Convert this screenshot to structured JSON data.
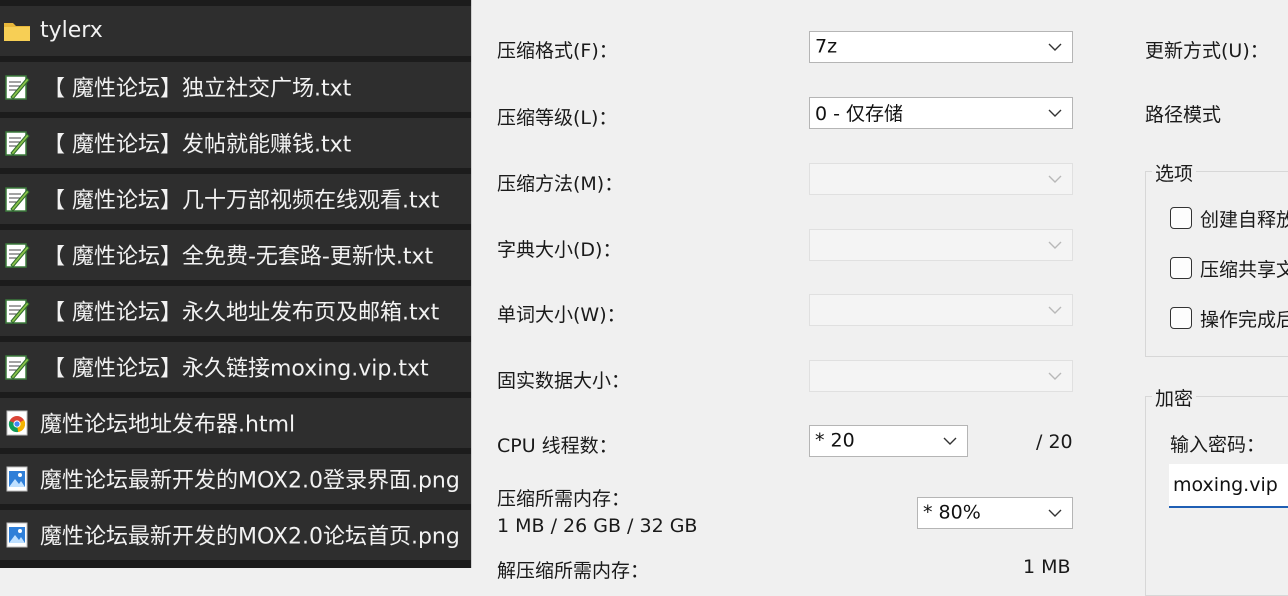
{
  "file_list": [
    {
      "name": "tylerx",
      "type": "folder",
      "icon": "folder-icon"
    },
    {
      "name": "【 魔性论坛】独立社交广场.txt",
      "type": "txt",
      "icon": "text-file-icon"
    },
    {
      "name": "【 魔性论坛】发帖就能赚钱.txt",
      "type": "txt",
      "icon": "text-file-icon"
    },
    {
      "name": "【 魔性论坛】几十万部视频在线观看.txt",
      "type": "txt",
      "icon": "text-file-icon"
    },
    {
      "name": "【 魔性论坛】全免费-无套路-更新快.txt",
      "type": "txt",
      "icon": "text-file-icon"
    },
    {
      "name": "【 魔性论坛】永久地址发布页及邮箱.txt",
      "type": "txt",
      "icon": "text-file-icon"
    },
    {
      "name": "【 魔性论坛】永久链接moxing.vip.txt",
      "type": "txt",
      "icon": "text-file-icon"
    },
    {
      "name": "魔性论坛地址发布器.html",
      "type": "html",
      "icon": "chrome-icon"
    },
    {
      "name": "魔性论坛最新开发的MOX2.0登录界面.png",
      "type": "image",
      "icon": "image-file-icon"
    },
    {
      "name": "魔性论坛最新开发的MOX2.0论坛首页.png",
      "type": "image",
      "icon": "image-file-icon"
    }
  ],
  "dialog": {
    "format": {
      "label": "压缩格式(F)：",
      "value": "7z"
    },
    "level": {
      "label": "压缩等级(L)：",
      "value": "0 - 仅存储"
    },
    "method": {
      "label": "压缩方法(M)：",
      "value": ""
    },
    "dict_size": {
      "label": "字典大小(D)：",
      "value": ""
    },
    "word_size": {
      "label": "单词大小(W)：",
      "value": ""
    },
    "solid_size": {
      "label": "固实数据大小：",
      "value": ""
    },
    "cpu_threads": {
      "label": "CPU 线程数：",
      "value": "*  20",
      "max": "/ 20"
    },
    "memory_compress": {
      "label": "压缩所需内存：",
      "detail": "1 MB / 26 GB / 32 GB",
      "value": "*  80%"
    },
    "memory_decompress": {
      "label": "解压缩所需内存：",
      "value": "1 MB"
    },
    "update_mode": {
      "label": "更新方式(U)："
    },
    "path_mode": {
      "label": "路径模式"
    },
    "options": {
      "title": "选项",
      "items": [
        {
          "label": "创建自释放",
          "checked": false
        },
        {
          "label": "压缩共享文",
          "checked": false
        },
        {
          "label": "操作完成后",
          "checked": false
        }
      ]
    },
    "encryption": {
      "title": "加密",
      "password_label": "输入密码：",
      "password_value": "moxing.vip"
    }
  },
  "colors": {
    "file_pane_bg": "#1c1c1c",
    "file_row_bg": "#2e2e2e",
    "dialog_bg": "#f0f0f0",
    "focus_accent": "#1f5fb4"
  }
}
